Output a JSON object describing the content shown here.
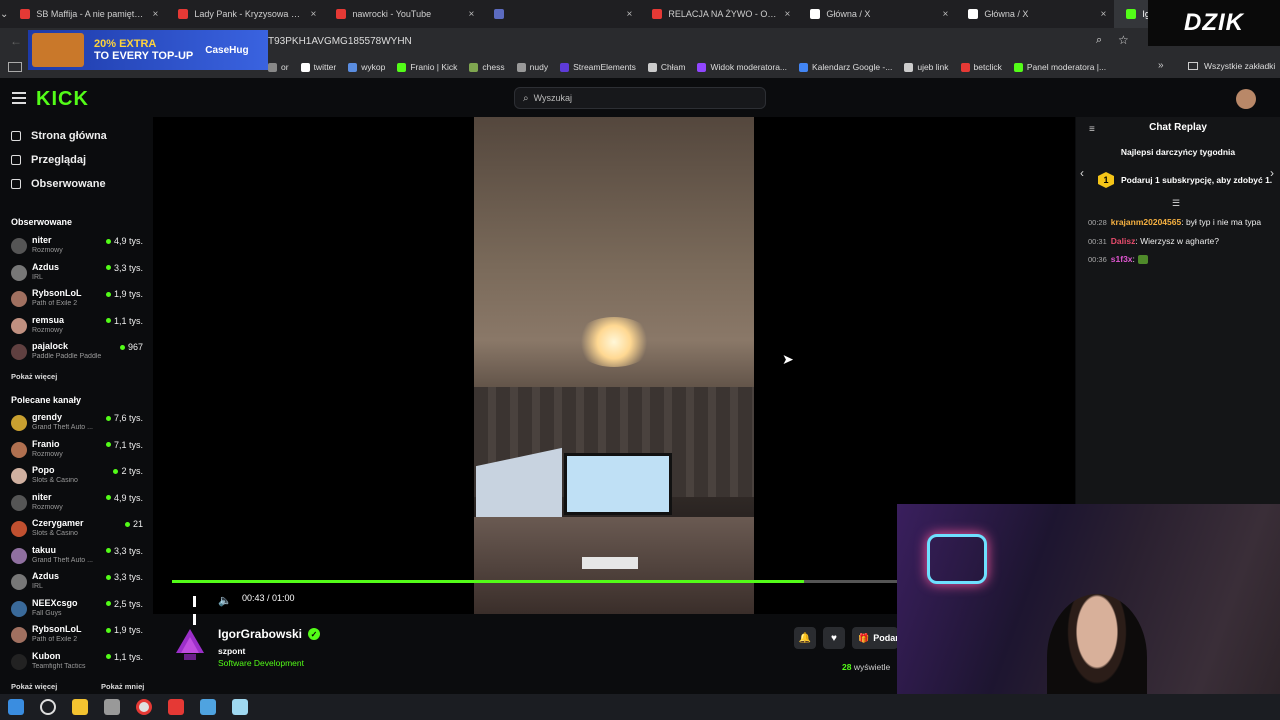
{
  "browser": {
    "tabs": [
      {
        "title": "SB Maffija - A nie pamiętasz jak",
        "color": "#e53935"
      },
      {
        "title": "Lady Pank - Kryzysowa Narzeczona",
        "color": "#e53935"
      },
      {
        "title": "nawrocki - YouTube",
        "color": "#e53935"
      },
      {
        "title": "",
        "color": "#5c6bc0"
      },
      {
        "title": "RELACJA NA ŻYWO - OGLĄDAJ",
        "color": "#e53935"
      },
      {
        "title": "Główna / X",
        "color": "#ffffff"
      },
      {
        "title": "Główna / X",
        "color": "#ffffff"
      },
      {
        "title": "IgorGrabowski - Watch clip",
        "color": "#53fc18"
      }
    ],
    "new_tab": "+",
    "url": "T93PKH1AVGMG185578WYHN",
    "bookmarks": [
      {
        "label": "or",
        "color": "#888888"
      },
      {
        "label": "twitter",
        "color": "#ffffff"
      },
      {
        "label": "wykop",
        "color": "#5a8de0"
      },
      {
        "label": "Franio | Kick",
        "color": "#53fc18"
      },
      {
        "label": "chess",
        "color": "#7fa650"
      },
      {
        "label": "nudy",
        "color": "#999999"
      },
      {
        "label": "StreamElements",
        "color": "#5e3bd8"
      },
      {
        "label": "Chłam",
        "color": "#cccccc"
      },
      {
        "label": "Widok moderatora...",
        "color": "#9146ff"
      },
      {
        "label": "Kalendarz Google -...",
        "color": "#4285f4"
      },
      {
        "label": "ujeb link",
        "color": "#cccccc"
      },
      {
        "label": "betclick",
        "color": "#e53935"
      },
      {
        "label": "Panel moderatora |...",
        "color": "#53fc18"
      }
    ],
    "all_bookmarks": "Wszystkie zakładki"
  },
  "ad": {
    "line1": "20% EXTRA",
    "line2": "TO EVERY TOP-UP",
    "brand": "CaseHug"
  },
  "overlay_logo": "DZIK",
  "header": {
    "logo": "KICK",
    "search_placeholder": "Wyszukaj"
  },
  "nav": [
    {
      "label": "Strona główna",
      "icon": "home-icon"
    },
    {
      "label": "Przeglądaj",
      "icon": "browse-icon"
    },
    {
      "label": "Obserwowane",
      "icon": "heart-icon"
    }
  ],
  "followed": {
    "title": "Obserwowane",
    "channels": [
      {
        "name": "niter",
        "category": "Rozmowy",
        "viewers": "4,9 tys.",
        "color": "#555555"
      },
      {
        "name": "Azdus",
        "category": "IRL",
        "viewers": "3,3 tys.",
        "color": "#777777"
      },
      {
        "name": "RybsonLoL",
        "category": "Path of Exile 2",
        "viewers": "1,9 tys.",
        "color": "#a07060"
      },
      {
        "name": "remsua",
        "category": "Rozmowy",
        "viewers": "1,1 tys.",
        "color": "#c09080"
      },
      {
        "name": "pajalock",
        "category": "Paddle Paddle Paddle",
        "viewers": "967",
        "color": "#604040"
      }
    ],
    "show_more": "Pokaż więcej"
  },
  "recommended": {
    "title": "Polecane kanały",
    "channels": [
      {
        "name": "grendy",
        "category": "Grand Theft Auto ...",
        "viewers": "7,6 tys.",
        "color": "#c9a030"
      },
      {
        "name": "Franio",
        "category": "Rozmowy",
        "viewers": "7,1 tys.",
        "color": "#b07050"
      },
      {
        "name": "Popo",
        "category": "Slots & Casino",
        "viewers": "2 tys.",
        "color": "#d0b0a0"
      },
      {
        "name": "niter",
        "category": "Rozmowy",
        "viewers": "4,9 tys.",
        "color": "#555555"
      },
      {
        "name": "Czerygamer",
        "category": "Slots & Casino",
        "viewers": "21",
        "color": "#c05030"
      },
      {
        "name": "takuu",
        "category": "Grand Theft Auto ...",
        "viewers": "3,3 tys.",
        "color": "#9070a0"
      },
      {
        "name": "Azdus",
        "category": "IRL",
        "viewers": "3,3 tys.",
        "color": "#777777"
      },
      {
        "name": "NEEXcsgo",
        "category": "Fall Guys",
        "viewers": "2,5 tys.",
        "color": "#3a6a9a"
      },
      {
        "name": "RybsonLoL",
        "category": "Path of Exile 2",
        "viewers": "1,9 tys.",
        "color": "#a07060"
      },
      {
        "name": "Kubon",
        "category": "Teamfight Tactics",
        "viewers": "1,1 tys.",
        "color": "#222222"
      }
    ],
    "show_more": "Pokaż więcej",
    "show_less": "Pokaż mniej"
  },
  "player": {
    "time": "00:43 / 01:00",
    "progress_fraction": 0.87
  },
  "stream": {
    "name": "IgorGrabowski",
    "title": "szpont",
    "category": "Software Development",
    "gift_label": "Podar",
    "views_count": "28",
    "views_label": "wyświetle"
  },
  "chat": {
    "title": "Chat Replay",
    "top_donors": "Najlepsi darczyńcy tygodnia",
    "promo_badge": "1",
    "promo": "Podaruj 1 subskrypcję, aby zdobyć 1.",
    "messages": [
      {
        "time": "00:28",
        "user": "krajanm20204565",
        "text": " był typ i nie ma typa",
        "color": "#f5b041"
      },
      {
        "time": "00:31",
        "user": "Dalisz",
        "text": " Wierzysz w agharte?",
        "color": "#e74c6c"
      },
      {
        "time": "00:36",
        "user": "s1f3x",
        "text": "",
        "color": "#e056d0"
      }
    ]
  },
  "colors": {
    "accent": "#53fc18",
    "background": "#0b0c0e"
  }
}
